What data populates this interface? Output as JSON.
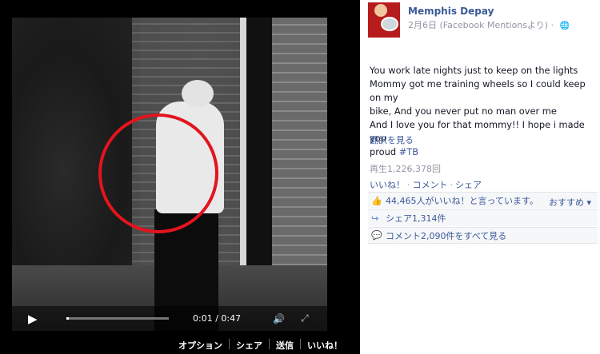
{
  "video": {
    "current_time": "0:01",
    "duration": "0:47",
    "time_display": "0:01 / 0:47",
    "progress": 0.02,
    "bottom_actions": [
      "オプション",
      "シェア",
      "送信",
      "いいね！"
    ]
  },
  "post": {
    "author": "Memphis Depay",
    "meta": "2月6日 (Facebook Mentionsより) ·",
    "body_lines": [
      "You work late nights just to keep on the lights",
      "Mommy got me training wheels so I could keep on my",
      "bike, And you never put no man over me",
      "And I love you for that mommy!! I hope i made you",
      "proud"
    ],
    "hashtag": "#TB",
    "translate": "翻訳を見る",
    "views": "再生1,226,378回",
    "actions": [
      "いいね！",
      "コメント",
      "シェア"
    ],
    "likes": "44,465人がいいね！と言っています。",
    "sort": "おすすめ ▾",
    "shares": "シェア1,314件",
    "comments": "コメント2,090件をすべて見る"
  },
  "icons": {
    "play": "play-icon",
    "volume": "volume-icon",
    "fullscreen": "fullscreen-icon",
    "like": "thumbs-up-icon",
    "share": "share-arrow-icon",
    "comment": "comment-bubble-icon",
    "privacy": "globe-icon"
  },
  "colors": {
    "link": "#3b5998",
    "annotation_circle": "#e3141e",
    "muted": "#9197a3"
  }
}
